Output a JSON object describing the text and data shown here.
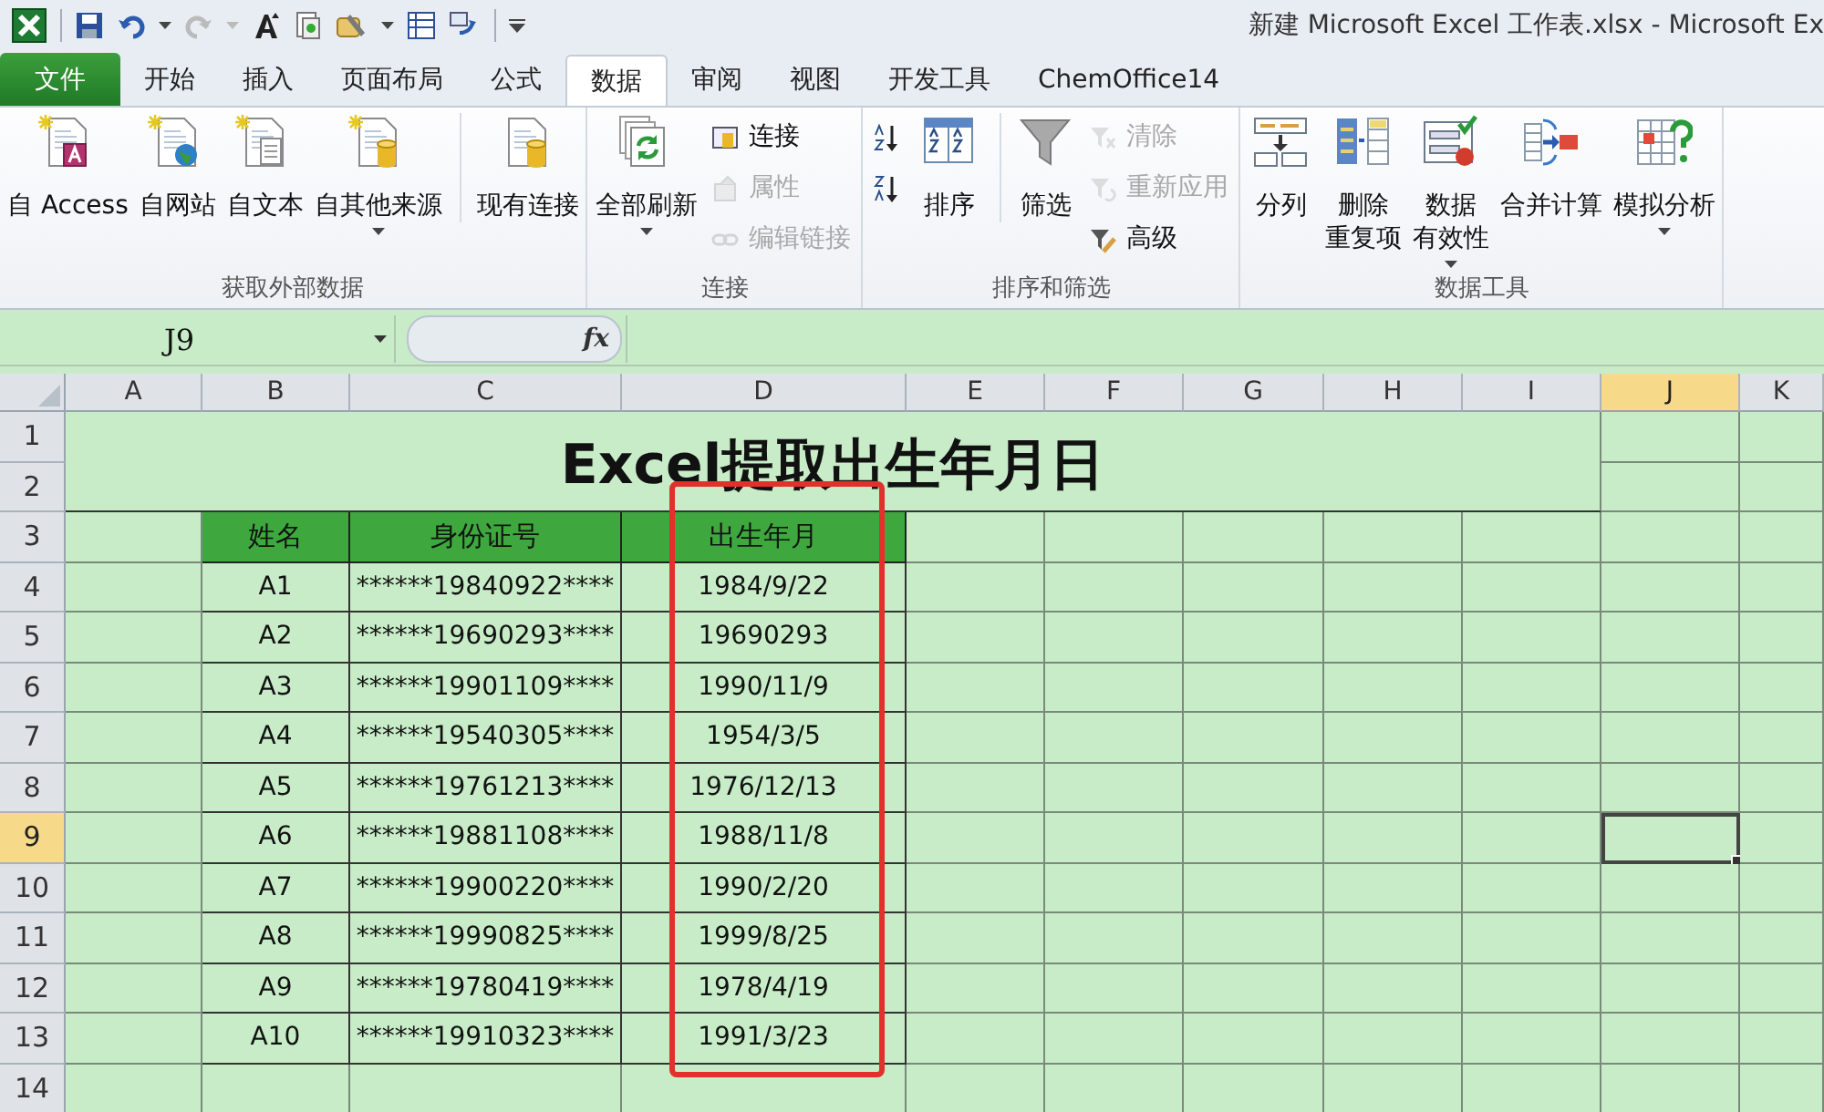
{
  "window": {
    "title": "新建 Microsoft Excel 工作表.xlsx - Microsoft Ex"
  },
  "tabs": [
    {
      "label": "文件",
      "kind": "file"
    },
    {
      "label": "开始",
      "kind": "tab",
      "selected": false
    },
    {
      "label": "插入",
      "kind": "tab",
      "selected": false
    },
    {
      "label": "页面布局",
      "kind": "tab",
      "selected": false
    },
    {
      "label": "公式",
      "kind": "tab",
      "selected": false
    },
    {
      "label": "数据",
      "kind": "tab",
      "selected": true
    },
    {
      "label": "审阅",
      "kind": "tab",
      "selected": false
    },
    {
      "label": "视图",
      "kind": "tab",
      "selected": false
    },
    {
      "label": "开发工具",
      "kind": "tab",
      "selected": false
    },
    {
      "label": "ChemOffice14",
      "kind": "tab",
      "selected": false
    }
  ],
  "ribbon": {
    "groups": [
      {
        "label": "获取外部数据",
        "buttons": [
          {
            "lines": [
              "自 Access"
            ],
            "kind": "large",
            "dropdown": false,
            "disabled": false,
            "separated": false
          },
          {
            "lines": [
              "自网站"
            ],
            "kind": "large",
            "dropdown": false,
            "disabled": false,
            "separated": false
          },
          {
            "lines": [
              "自文本"
            ],
            "kind": "large",
            "dropdown": false,
            "disabled": false,
            "separated": false
          },
          {
            "lines": [
              "自其他来源"
            ],
            "kind": "large",
            "dropdown": true,
            "disabled": false,
            "separated": false
          },
          {
            "lines": [
              "现有连接"
            ],
            "kind": "large",
            "dropdown": false,
            "disabled": false,
            "separated": true
          }
        ]
      },
      {
        "label": "连接",
        "buttons": [
          {
            "lines": [
              "全部刷新"
            ],
            "kind": "large",
            "dropdown": true,
            "disabled": false,
            "separated": false
          },
          {
            "lines": [
              "连接"
            ],
            "kind": "small",
            "dropdown": false,
            "disabled": false,
            "separated": false
          },
          {
            "lines": [
              "属性"
            ],
            "kind": "small",
            "dropdown": false,
            "disabled": true,
            "separated": false
          },
          {
            "lines": [
              "编辑链接"
            ],
            "kind": "small",
            "dropdown": false,
            "disabled": true,
            "separated": false
          }
        ]
      },
      {
        "label": "排序和筛选",
        "buttons": [
          {
            "kind": "small",
            "dropdown": false,
            "disabled": false,
            "separated": false
          },
          {
            "kind": "small",
            "dropdown": false,
            "disabled": false,
            "separated": false
          },
          {
            "lines": [
              "排序"
            ],
            "kind": "large",
            "dropdown": false,
            "disabled": false,
            "separated": false
          },
          {
            "lines": [
              "筛选"
            ],
            "kind": "large",
            "dropdown": false,
            "disabled": false,
            "separated": true
          },
          {
            "lines": [
              "清除"
            ],
            "kind": "small",
            "dropdown": false,
            "disabled": true,
            "separated": false
          },
          {
            "lines": [
              "重新应用"
            ],
            "kind": "small",
            "dropdown": false,
            "disabled": true,
            "separated": false
          },
          {
            "lines": [
              "高级"
            ],
            "kind": "small",
            "dropdown": false,
            "disabled": false,
            "separated": false
          }
        ]
      },
      {
        "label": "数据工具",
        "buttons": [
          {
            "lines": [
              "分列"
            ],
            "kind": "large",
            "dropdown": false,
            "disabled": false,
            "separated": false
          },
          {
            "lines": [
              "删除",
              "重复项"
            ],
            "kind": "large",
            "dropdown": false,
            "disabled": false,
            "separated": false
          },
          {
            "lines": [
              "数据",
              "有效性"
            ],
            "kind": "large",
            "dropdown": true,
            "disabled": false,
            "separated": false
          },
          {
            "lines": [
              "合并计算"
            ],
            "kind": "large",
            "dropdown": false,
            "disabled": false,
            "separated": false
          },
          {
            "lines": [
              "模拟分析"
            ],
            "kind": "large",
            "dropdown": true,
            "disabled": false,
            "separated": false
          }
        ]
      }
    ]
  },
  "formula_bar": {
    "name_box": "J9",
    "function_label": "fx"
  },
  "sheet": {
    "columns": [
      {
        "label": "A",
        "selected": false
      },
      {
        "label": "B",
        "selected": false
      },
      {
        "label": "C",
        "selected": false
      },
      {
        "label": "D",
        "selected": false
      },
      {
        "label": "E",
        "selected": false
      },
      {
        "label": "F",
        "selected": false
      },
      {
        "label": "G",
        "selected": false
      },
      {
        "label": "H",
        "selected": false
      },
      {
        "label": "I",
        "selected": false
      },
      {
        "label": "J",
        "selected": true
      },
      {
        "label": "K",
        "selected": false
      }
    ],
    "rows": [
      {
        "label": "1",
        "selected": false
      },
      {
        "label": "2",
        "selected": false
      },
      {
        "label": "3",
        "selected": false
      },
      {
        "label": "4",
        "selected": false
      },
      {
        "label": "5",
        "selected": false
      },
      {
        "label": "6",
        "selected": false
      },
      {
        "label": "7",
        "selected": false
      },
      {
        "label": "8",
        "selected": false
      },
      {
        "label": "9",
        "selected": true
      },
      {
        "label": "10",
        "selected": false
      },
      {
        "label": "11",
        "selected": false
      },
      {
        "label": "12",
        "selected": false
      },
      {
        "label": "13",
        "selected": false
      },
      {
        "label": "14",
        "selected": false
      }
    ],
    "title": "Excel提取出生年月日",
    "table": {
      "columns": [
        "姓名",
        "身份证号",
        "出生年月"
      ],
      "rows": [
        [
          "A1",
          "******19840922****",
          "1984/9/22"
        ],
        [
          "A2",
          "******19690293****",
          "19690293"
        ],
        [
          "A3",
          "******19901109****",
          "1990/11/9"
        ],
        [
          "A4",
          "******19540305****",
          "1954/3/5"
        ],
        [
          "A5",
          "******19761213****",
          "1976/12/13"
        ],
        [
          "A6",
          "******19881108****",
          "1988/11/8"
        ],
        [
          "A7",
          "******19900220****",
          "1990/2/20"
        ],
        [
          "A8",
          "******19990825****",
          "1999/8/25"
        ],
        [
          "A9",
          "******19780419****",
          "1978/4/19"
        ],
        [
          "A10",
          "******19910323****",
          "1991/3/23"
        ]
      ]
    },
    "annotation": {
      "kind": "frame"
    }
  }
}
